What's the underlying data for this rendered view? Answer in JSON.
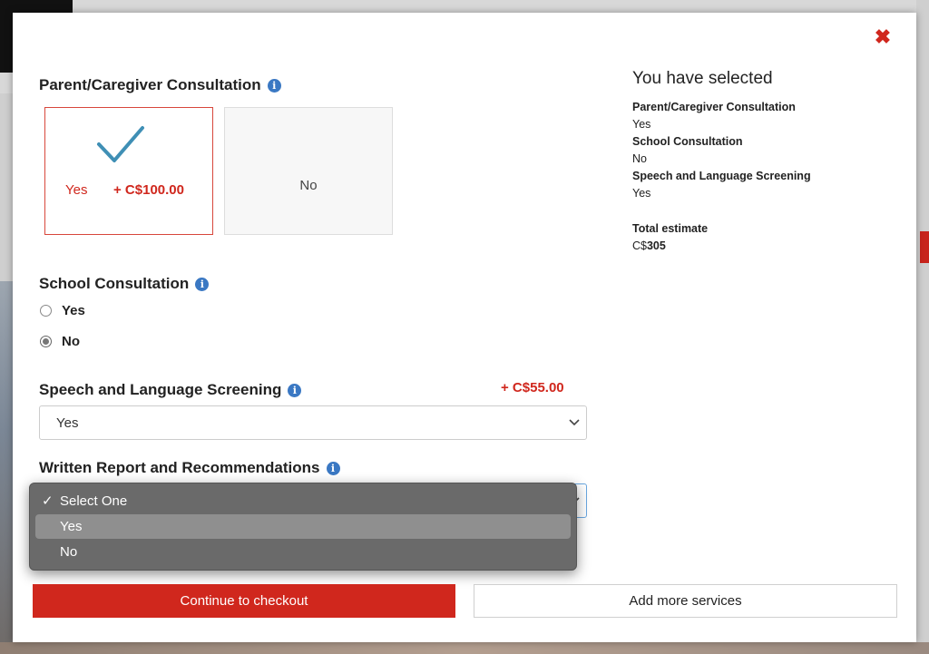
{
  "modal": {
    "close_icon": "close-icon",
    "parent_consultation": {
      "title": "Parent/Caregiver Consultation",
      "info_icon": "i",
      "options": [
        {
          "label": "Yes",
          "price": "+ C$100.00",
          "selected": true
        },
        {
          "label": "No",
          "selected": false
        }
      ]
    },
    "school_consultation": {
      "title": "School Consultation",
      "info_icon": "i",
      "options": [
        {
          "label": "Yes",
          "checked": false
        },
        {
          "label": "No",
          "checked": true
        }
      ]
    },
    "speech_screening": {
      "title": "Speech and Language Screening",
      "info_icon": "i",
      "price": "+ C$55.00",
      "selected_value": "Yes"
    },
    "written_report": {
      "title": "Written Report and Recommendations",
      "info_icon": "i",
      "dropdown_options": [
        {
          "label": "Select One",
          "checked": true,
          "highlighted": false
        },
        {
          "label": "Yes",
          "checked": false,
          "highlighted": true
        },
        {
          "label": "No",
          "checked": false,
          "highlighted": false
        }
      ],
      "checkmark": "✓"
    },
    "summary": {
      "heading": "You have selected",
      "items": [
        {
          "label": "Parent/Caregiver Consultation",
          "value": "Yes"
        },
        {
          "label": "School Consultation",
          "value": "No"
        },
        {
          "label": "Speech and Language Screening",
          "value": "Yes"
        }
      ],
      "total_label": "Total estimate",
      "total_currency": "C$",
      "total_amount": "305"
    },
    "buttons": {
      "checkout": "Continue to checkout",
      "add_more": "Add more services"
    }
  },
  "colors": {
    "accent_red": "#d0271d",
    "check_blue": "#3f8fb5",
    "info_blue": "#3a78c3",
    "dropdown_bg": "#6a6a6a",
    "dropdown_highlight": "#8f8f8f"
  }
}
